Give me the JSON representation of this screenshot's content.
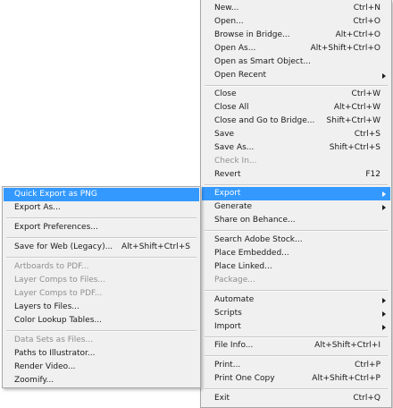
{
  "file_menu": {
    "items": [
      {
        "label": "New...",
        "shortcut": "Ctrl+N",
        "enabled": true,
        "submenu": false
      },
      {
        "label": "Open...",
        "shortcut": "Ctrl+O",
        "enabled": true,
        "submenu": false
      },
      {
        "label": "Browse in Bridge...",
        "shortcut": "Alt+Ctrl+O",
        "enabled": true,
        "submenu": false
      },
      {
        "label": "Open As...",
        "shortcut": "Alt+Shift+Ctrl+O",
        "enabled": true,
        "submenu": false
      },
      {
        "label": "Open as Smart Object...",
        "shortcut": "",
        "enabled": true,
        "submenu": false
      },
      {
        "label": "Open Recent",
        "shortcut": "",
        "enabled": true,
        "submenu": true
      },
      {
        "label": "Close",
        "shortcut": "Ctrl+W",
        "enabled": true,
        "submenu": false
      },
      {
        "label": "Close All",
        "shortcut": "Alt+Ctrl+W",
        "enabled": true,
        "submenu": false
      },
      {
        "label": "Close and Go to Bridge...",
        "shortcut": "Shift+Ctrl+W",
        "enabled": true,
        "submenu": false
      },
      {
        "label": "Save",
        "shortcut": "Ctrl+S",
        "enabled": true,
        "submenu": false
      },
      {
        "label": "Save As...",
        "shortcut": "Shift+Ctrl+S",
        "enabled": true,
        "submenu": false
      },
      {
        "label": "Check In...",
        "shortcut": "",
        "enabled": false,
        "submenu": false
      },
      {
        "label": "Revert",
        "shortcut": "F12",
        "enabled": true,
        "submenu": false
      },
      {
        "label": "Export",
        "shortcut": "",
        "enabled": true,
        "submenu": true,
        "highlighted": true
      },
      {
        "label": "Generate",
        "shortcut": "",
        "enabled": true,
        "submenu": true
      },
      {
        "label": "Share on Behance...",
        "shortcut": "",
        "enabled": true,
        "submenu": false
      },
      {
        "label": "Search Adobe Stock...",
        "shortcut": "",
        "enabled": true,
        "submenu": false
      },
      {
        "label": "Place Embedded...",
        "shortcut": "",
        "enabled": true,
        "submenu": false
      },
      {
        "label": "Place Linked...",
        "shortcut": "",
        "enabled": true,
        "submenu": false
      },
      {
        "label": "Package...",
        "shortcut": "",
        "enabled": false,
        "submenu": false
      },
      {
        "label": "Automate",
        "shortcut": "",
        "enabled": true,
        "submenu": true
      },
      {
        "label": "Scripts",
        "shortcut": "",
        "enabled": true,
        "submenu": true
      },
      {
        "label": "Import",
        "shortcut": "",
        "enabled": true,
        "submenu": true
      },
      {
        "label": "File Info...",
        "shortcut": "Alt+Shift+Ctrl+I",
        "enabled": true,
        "submenu": false
      },
      {
        "label": "Print...",
        "shortcut": "Ctrl+P",
        "enabled": true,
        "submenu": false
      },
      {
        "label": "Print One Copy",
        "shortcut": "Alt+Shift+Ctrl+P",
        "enabled": true,
        "submenu": false
      },
      {
        "label": "Exit",
        "shortcut": "Ctrl+Q",
        "enabled": true,
        "submenu": false
      }
    ]
  },
  "export_menu": {
    "items": [
      {
        "label": "Quick Export as PNG",
        "shortcut": "",
        "enabled": true,
        "highlighted": true
      },
      {
        "label": "Export As...",
        "shortcut": "",
        "enabled": true
      },
      {
        "label": "Export Preferences...",
        "shortcut": "",
        "enabled": true
      },
      {
        "label": "Save for Web (Legacy)...",
        "shortcut": "Alt+Shift+Ctrl+S",
        "enabled": true
      },
      {
        "label": "Artboards to PDF...",
        "shortcut": "",
        "enabled": false
      },
      {
        "label": "Layer Comps to Files...",
        "shortcut": "",
        "enabled": false
      },
      {
        "label": "Layer Comps to PDF...",
        "shortcut": "",
        "enabled": false
      },
      {
        "label": "Layers to Files...",
        "shortcut": "",
        "enabled": true
      },
      {
        "label": "Color Lookup Tables...",
        "shortcut": "",
        "enabled": true
      },
      {
        "label": "Data Sets as Files...",
        "shortcut": "",
        "enabled": false
      },
      {
        "label": "Paths to Illustrator...",
        "shortcut": "",
        "enabled": true
      },
      {
        "label": "Render Video...",
        "shortcut": "",
        "enabled": true
      },
      {
        "label": "Zoomify...",
        "shortcut": "",
        "enabled": true
      }
    ]
  },
  "colors": {
    "menu_background": "#f0f0f0",
    "highlight": "#3399ff",
    "disabled_text": "#8f8f8f",
    "text": "#1a1a1a"
  }
}
